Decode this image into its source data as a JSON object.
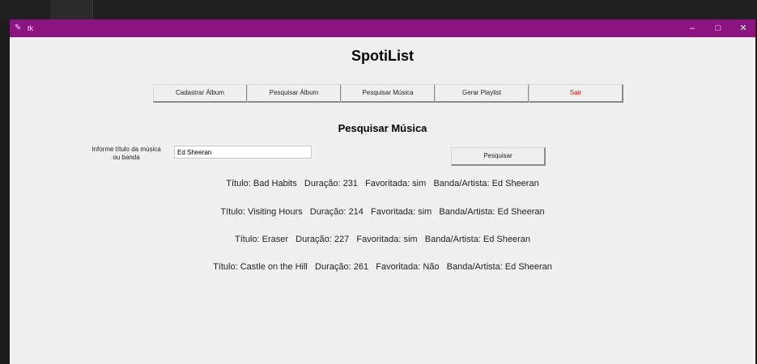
{
  "window": {
    "title": "tk",
    "controls": {
      "minimize": "–",
      "maximize": "□",
      "close": "✕"
    },
    "titlebar_color": "#8b1480"
  },
  "app": {
    "heading": "SpotiList"
  },
  "menu": {
    "items": [
      {
        "label": "Cadastrar Álbum"
      },
      {
        "label": "Pesquisar Álbum"
      },
      {
        "label": "Pesquisar Música"
      },
      {
        "label": "Gerar Playlist"
      },
      {
        "label": "Sair",
        "color": "#e01010"
      }
    ]
  },
  "search": {
    "heading": "Pesquisar Música",
    "label_line1": "Informe título da música",
    "label_line2": "ou banda",
    "value": "Ed Sheeran",
    "button_label": "Pesquisar"
  },
  "results": [
    {
      "text": "Título: Bad Habits   Duração: 231   Favoritada: sim   Banda/Artista: Ed Sheeran"
    },
    {
      "text": "Título: Visiting Hours   Duração: 214   Favoritada: sim   Banda/Artista: Ed Sheeran"
    },
    {
      "text": "Título: Eraser   Duração: 227   Favoritada: sim   Banda/Artista: Ed Sheeran"
    },
    {
      "text": "Título: Castle on the Hill   Duração: 261   Favoritada: Não   Banda/Artista: Ed Sheeran"
    }
  ]
}
